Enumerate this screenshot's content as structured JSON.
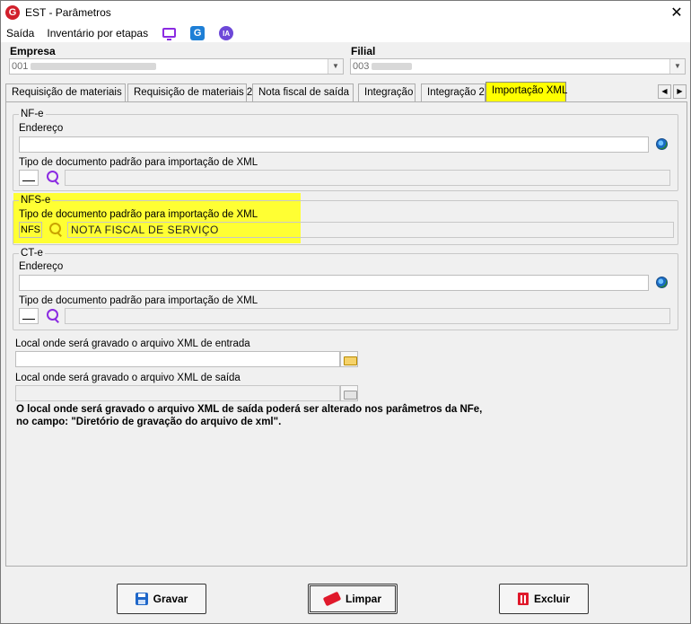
{
  "window": {
    "title": "EST - Parâmetros",
    "close_glyph": "✕"
  },
  "menu": {
    "items": [
      "Saída",
      "Inventário por etapas"
    ],
    "ia_label": "IA",
    "g_label": "G"
  },
  "empresa": {
    "label": "Empresa",
    "value": "001"
  },
  "filial": {
    "label": "Filial",
    "value": "003"
  },
  "tabs": [
    "Requisição de materiais",
    "Requisição de materiais 2",
    "Nota fiscal de saída",
    "Integração",
    "Integração 2",
    "Importação XML"
  ],
  "nfe": {
    "legend": "NF-e",
    "endereco_label": "Endereço",
    "endereco_value": "",
    "tipo_label": "Tipo de documento padrão para importação de XML",
    "tipo_code": "",
    "tipo_desc": ""
  },
  "nfse": {
    "legend": "NFS-e",
    "tipo_label": "Tipo de documento padrão para importação de XML",
    "tipo_code": "NFS",
    "tipo_desc": "NOTA FISCAL DE SERVIÇO"
  },
  "cte": {
    "legend": "CT-e",
    "endereco_label": "Endereço",
    "endereco_value": "",
    "tipo_label": "Tipo de documento padrão para importação de XML",
    "tipo_code": "",
    "tipo_desc": ""
  },
  "xml_entrada": {
    "label": "Local onde será gravado o arquivo XML de entrada",
    "value": ""
  },
  "xml_saida": {
    "label": "Local onde será gravado o arquivo XML de saída",
    "value": ""
  },
  "note": "O local onde será gravado o arquivo XML de saída poderá ser alterado nos parâmetros da NFe, no campo: \"Diretório de gravação do arquivo de xml\".",
  "buttons": {
    "gravar": "Gravar",
    "limpar": "Limpar",
    "excluir": "Excluir"
  },
  "colors": {
    "highlight": "#ffff00",
    "accent_purple": "#8b2be2",
    "danger": "#e0192b",
    "save_blue": "#1f67c9"
  }
}
